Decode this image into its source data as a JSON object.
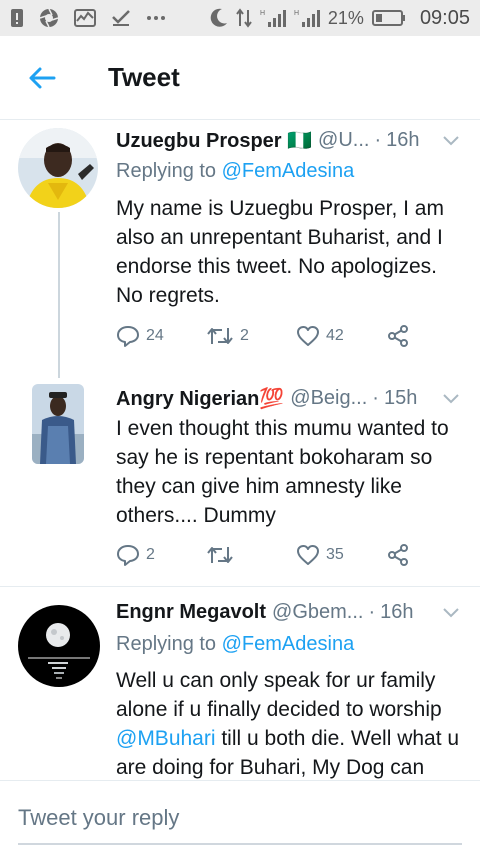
{
  "status_bar": {
    "battery_percent": "21%",
    "time": "09:05",
    "icons": [
      "sim-alert-icon",
      "aperture-icon",
      "pulse-icon",
      "check-icon",
      "more-dots-icon",
      "moon-icon",
      "data-arrows-icon",
      "signal-1-icon",
      "signal-2-icon",
      "battery-icon"
    ]
  },
  "header": {
    "title": "Tweet",
    "back_icon": "arrow-left-icon"
  },
  "tweets": [
    {
      "name": "Uzuegbu Prosper 🇳🇬",
      "handle": "@U...",
      "time": "16h",
      "replying_prefix": "Replying to",
      "replying_to": "@FemAdesina",
      "text": "My name is Uzuegbu Prosper, I am also an unrepentant Buharist, and I endorse this tweet. No apologizes. No regrets.",
      "replies": "24",
      "retweets": "2",
      "likes": "42"
    },
    {
      "name": "Angry Nigerian💯",
      "handle": "@Beig...",
      "time": "15h",
      "text": "I even thought this mumu wanted to say he is repentant bokoharam so they can give him amnesty like others.... Dummy",
      "replies": "2",
      "retweets": "",
      "likes": "35"
    },
    {
      "name": "Engnr Megavolt",
      "handle": "@Gbem...",
      "time": "16h",
      "replying_prefix": "Replying to",
      "replying_to": "@FemAdesina",
      "text_before_mention": "Well u can only speak for ur family alone if u finally decided to worship ",
      "mention": "@MBuhari",
      "text_after_mention": " till u both die. Well what u are doing for Buhari, My Dog can"
    }
  ],
  "separator_dot": "·",
  "composer": {
    "placeholder": "Tweet your reply"
  },
  "colors": {
    "accent": "#1da1f2",
    "secondary_text": "#657786",
    "divider": "#e6ecf0"
  }
}
